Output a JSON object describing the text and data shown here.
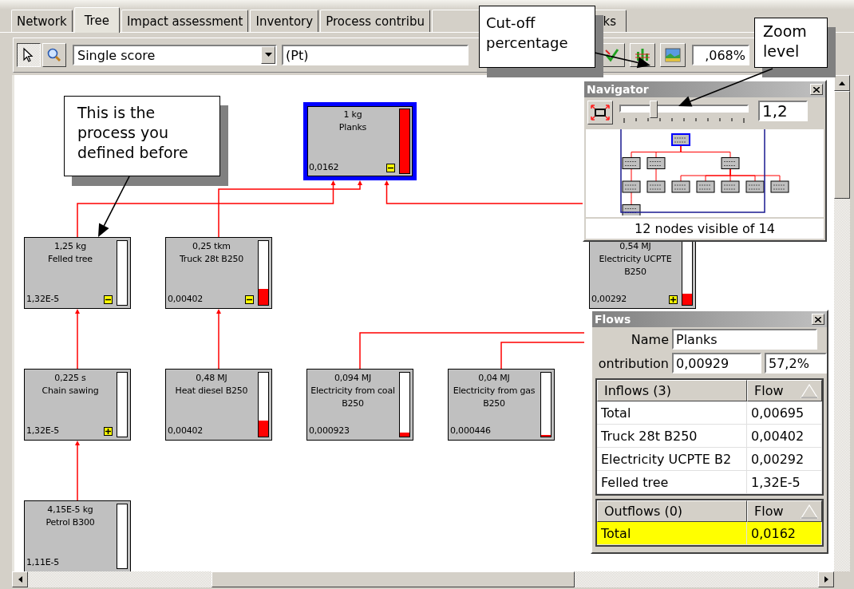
{
  "tabs": [
    {
      "label": "Network",
      "selected": false
    },
    {
      "label": "Tree",
      "selected": true
    },
    {
      "label": "Impact assessment",
      "selected": false
    },
    {
      "label": "Inventory",
      "selected": false
    },
    {
      "label": "Process contribu",
      "selected": false
    },
    {
      "label": "ks",
      "selected": false
    }
  ],
  "toolbar": {
    "tools": [
      {
        "kind": "pointer",
        "selected": true
      },
      {
        "kind": "zoom",
        "selected": false
      }
    ],
    "method": {
      "value": "Single score"
    },
    "unit": {
      "value": "(Pt)"
    },
    "actions": [
      {
        "kind": "check"
      },
      {
        "kind": "bars"
      },
      {
        "kind": "image"
      }
    ],
    "cutoff": {
      "value": ",068%"
    }
  },
  "tree": {
    "amount": "1 kg",
    "name": "Planks",
    "score": "0,0162",
    "level": 1,
    "expanded": true,
    "selected": true,
    "children": [
      {
        "amount": "1,25 kg",
        "name": "Felled tree",
        "score": "1,32E-5",
        "level": 0,
        "expanded": true,
        "selected": false,
        "children": [
          {
            "amount": "0,225 s",
            "name": "Chain sawing",
            "score": "1,32E-5",
            "level": 0,
            "expanded": false,
            "selected": false,
            "children": [
              {
                "amount": "4,15E-5 kg",
                "name": "Petrol B300",
                "score": "1,11E-5",
                "level": 0,
                "selected": false
              }
            ]
          }
        ]
      },
      {
        "amount": "0,25 tkm",
        "name": "Truck 28t B250",
        "score": "0,00402",
        "level": 0.25,
        "expanded": true,
        "selected": false,
        "children": [
          {
            "amount": "0,48 MJ",
            "name": "Heat diesel B250",
            "score": "0,00402",
            "level": 0.25,
            "selected": false
          }
        ]
      },
      {
        "amount": "0,54 MJ",
        "name": "Electricity UCPTE B250",
        "score": "0,00292",
        "level": 0.18,
        "expanded": false,
        "selected": false,
        "children": [
          {
            "amount": "0,094 MJ",
            "name": "Electricity from coal B250",
            "score": "0,000923",
            "level": 0.06,
            "selected": false
          },
          {
            "amount": "0,04 MJ",
            "name": "Electricity from gas B250",
            "score": "0,000446",
            "level": 0.03,
            "selected": false
          }
        ]
      }
    ]
  },
  "navigator": {
    "title": "Navigator",
    "zoom_slider": {
      "level": 0.25
    },
    "zoom_value": "1,2",
    "status": "12 nodes visible of 14"
  },
  "flows": {
    "title": "Flows",
    "name_label": "Name",
    "name_value": "Planks",
    "contribution_label": "ontribution",
    "contribution_value": "0,00929",
    "contribution_percent": "57,2%",
    "inflows": {
      "columns": [
        "Inflows (3)",
        "Flow"
      ],
      "rows": [
        {
          "name": "Total",
          "flow": "0,00695",
          "selected": false
        },
        {
          "name": "Truck 28t B250",
          "flow": "0,00402",
          "selected": false
        },
        {
          "name": "Electricity UCPTE B2",
          "flow": "0,00292",
          "selected": false
        },
        {
          "name": "Felled tree",
          "flow": "1,32E-5",
          "selected": false
        }
      ]
    },
    "outflows": {
      "columns": [
        "Outflows (0)",
        "Flow"
      ],
      "rows": [
        {
          "name": "Total",
          "flow": "0,0162",
          "selected": true
        }
      ]
    }
  },
  "callouts": [
    {
      "text": "Cut-off percentage"
    },
    {
      "text": "Zoom level"
    },
    {
      "text": "This is the process you defined before"
    }
  ]
}
